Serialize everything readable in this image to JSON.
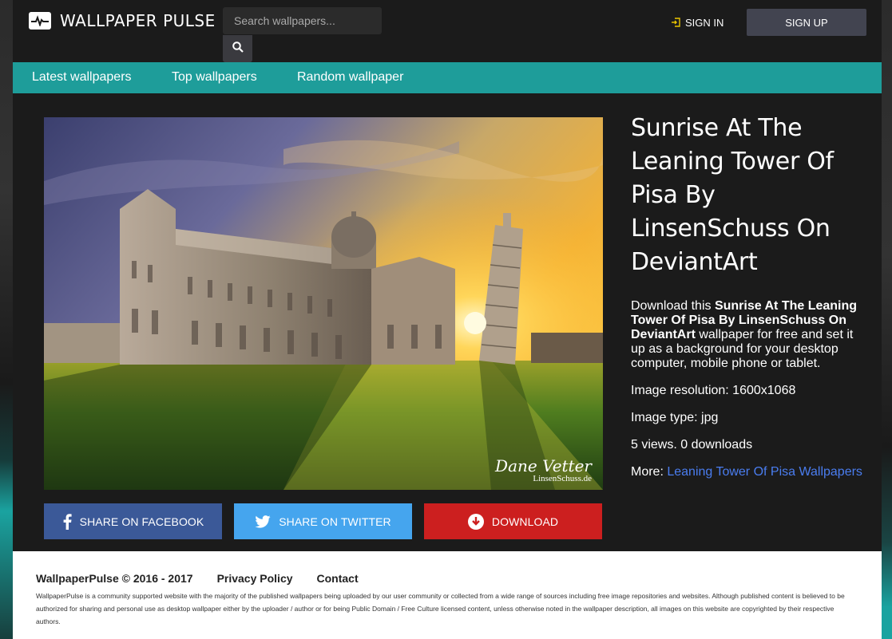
{
  "brand": {
    "name": "WALLPAPER PULSE",
    "logo_icon": "pulse-icon"
  },
  "search": {
    "placeholder": "Search wallpapers...",
    "button_icon": "search-icon"
  },
  "auth": {
    "signin_label": "SIGN IN",
    "signin_icon": "login-icon",
    "signup_label": "SIGN UP"
  },
  "nav": {
    "items": [
      {
        "label": "Latest wallpapers"
      },
      {
        "label": "Top wallpapers"
      },
      {
        "label": "Random wallpaper"
      }
    ]
  },
  "wallpaper": {
    "watermark_name": "Dane Vetter",
    "watermark_site": "LinsenSchuss.de"
  },
  "actions": {
    "facebook_label": "SHARE ON FACEBOOK",
    "twitter_label": "SHARE ON TWITTER",
    "download_label": "DOWNLOAD"
  },
  "info": {
    "title": "Sunrise At The Leaning Tower Of Pisa By LinsenSchuss On DeviantArt",
    "desc_prefix": "Download this ",
    "desc_bold": "Sunrise At The Leaning Tower Of Pisa By LinsenSchuss On DeviantArt",
    "desc_suffix": " wallpaper for free and set it up as a background for your desktop computer, mobile phone or tablet.",
    "resolution": "Image resolution: 1600x1068",
    "type": "Image type: jpg",
    "stats": "5 views. 0 downloads",
    "more_label": "More: ",
    "more_link": "Leaning Tower Of Pisa Wallpapers"
  },
  "footer": {
    "copyright": "WallpaperPulse © 2016 - 2017",
    "privacy": "Privacy Policy",
    "contact": "Contact",
    "disclaimer": "WallpaperPulse is a community supported website with the majority of the published wallpapers being uploaded by our user community or collected from a wide range of sources including free image repositories and websites. Although published content is believed to be authorized for sharing and personal use as desktop wallpaper either by the uploader / author or for being Public Domain / Free Culture licensed content, unless otherwise noted in the wallpaper description, all images on this website are copyrighted by their respective authors."
  },
  "colors": {
    "nav": "#1e9d9a",
    "facebook": "#3b5998",
    "twitter": "#45a5ee",
    "download": "#cc1f1f",
    "link": "#4a7df0"
  }
}
